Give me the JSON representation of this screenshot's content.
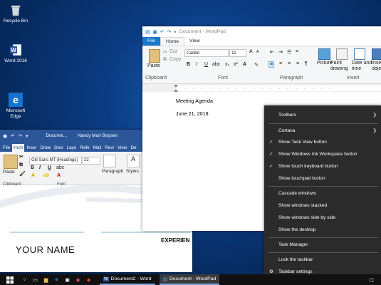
{
  "desktop": {
    "icons": [
      {
        "label": "Recycle Bin"
      },
      {
        "label": "Word 2016"
      },
      {
        "label": "Microsoft\nEdge"
      }
    ]
  },
  "word": {
    "title": "Docume...",
    "author": "Nancy Muir Boysen",
    "tabs": [
      "File",
      "Hom",
      "Inser",
      "Draw",
      "Desi",
      "Layo",
      "Refe",
      "Mail",
      "Revi",
      "View",
      "De"
    ],
    "font": "Gill Sans MT (Headings)",
    "size": "22",
    "paste": "Paste",
    "paragraph": "Paragraph",
    "styles": "Styles",
    "clipboard": "Clipboard",
    "font_group": "Font",
    "doc_name": "YOUR NAME",
    "doc_exp": "EXPERIEN"
  },
  "wordpad": {
    "title": "Document - WordPad",
    "tabs": [
      "File",
      "Home",
      "View"
    ],
    "clipboard": "Clipboard",
    "font_group": "Font",
    "paragraph_group": "Paragraph",
    "insert_group": "Insert",
    "font": "Calibri",
    "size": "11",
    "paste": "Paste",
    "cut": "Cut",
    "copy": "Copy",
    "picture": "Picture",
    "paint": "Paint\ndrawing",
    "datetime": "Date and\ntime",
    "insertobj": "Insert\nobject",
    "line1": "Meeting Agenda",
    "line2": "June 21, 2018"
  },
  "context_menu": {
    "items": [
      {
        "label": "Toolbars",
        "submenu": true
      },
      {
        "label": "Cortana",
        "submenu": true
      },
      {
        "label": "Show Task View button",
        "checked": true
      },
      {
        "label": "Show Windows Ink Workspace button",
        "checked": true
      },
      {
        "label": "Show touch keyboard button",
        "checked": true
      },
      {
        "label": "Show touchpad button",
        "checked": false
      },
      {
        "label": "Cascade windows"
      },
      {
        "label": "Show windows stacked"
      },
      {
        "label": "Show windows side by side"
      },
      {
        "label": "Show the desktop"
      },
      {
        "label": "Task Manager"
      },
      {
        "label": "Lock the taskbar"
      },
      {
        "label": "Taskbar settings"
      }
    ]
  },
  "taskbar": {
    "apps": [
      {
        "label": "Document2 - Word"
      },
      {
        "label": "Document - WordPad"
      }
    ]
  }
}
